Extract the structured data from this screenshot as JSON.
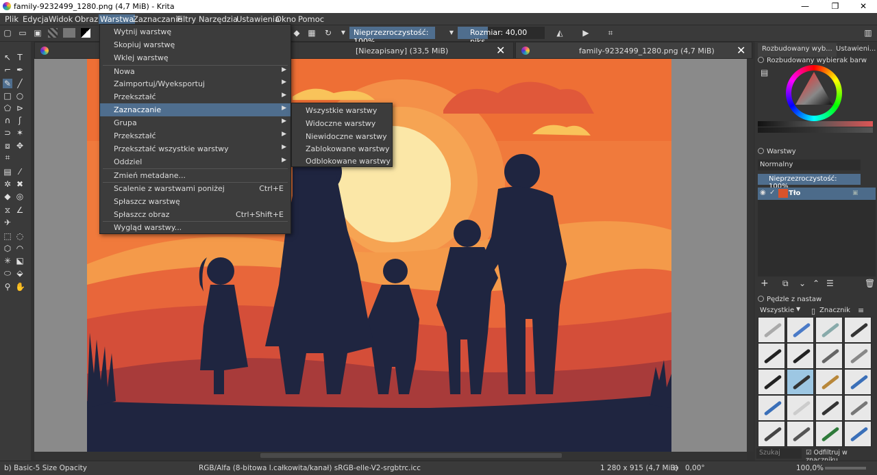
{
  "window": {
    "title": "family-9232499_1280.png (4,7 MiB)  - Krita",
    "minimize": "—",
    "maximize": "❐",
    "close": "✕"
  },
  "menubar": [
    "Plik",
    "Edycja",
    "Widok",
    "Obraz",
    "Warstwa",
    "Zaznaczanie",
    "Filtry",
    "Narzędzia",
    "Ustawienia",
    "Okno",
    "Pomoc"
  ],
  "menubar_active": "Warstwa",
  "toolbar": {
    "opacity": "Nieprzezroczystość: 100%",
    "size": "Rozmiar: 40,00 piks."
  },
  "tabs": [
    {
      "label": "[Niezapisany]  (33,5 MiB)",
      "close": "✕"
    },
    {
      "label": "family-9232499_1280.png (4,7 MiB)",
      "close": "✕"
    }
  ],
  "layer_menu": {
    "items": [
      {
        "label": "Wytnij warstwę"
      },
      {
        "label": "Skopiuj warstwę"
      },
      {
        "label": "Wklej warstwę"
      },
      {
        "label": "Nowa",
        "submenu": true
      },
      {
        "label": "Zaimportuj/Wyeksportuj",
        "submenu": true
      },
      {
        "label": "Przekształć",
        "submenu": true
      },
      {
        "label": "Zaznaczanie",
        "submenu": true,
        "highlighted": true
      },
      {
        "label": "Grupa",
        "submenu": true
      },
      {
        "label": "Przekształć",
        "submenu": true
      },
      {
        "label": "Przekształć wszystkie warstwy",
        "submenu": true
      },
      {
        "label": "Oddziel",
        "submenu": true
      },
      {
        "label": "Zmień metadane..."
      },
      {
        "label": "Scalenie z warstwami poniżej",
        "shortcut": "Ctrl+E"
      },
      {
        "label": "Spłaszcz warstwę"
      },
      {
        "label": "Spłaszcz obraz",
        "shortcut": "Ctrl+Shift+E"
      },
      {
        "label": "Wygląd warstwy..."
      }
    ]
  },
  "selection_submenu": {
    "items": [
      "Wszystkie warstwy",
      "Widoczne warstwy",
      "Niewidoczne warstwy",
      "Zablokowane warstwy",
      "Odblokowane warstwy"
    ]
  },
  "dock": {
    "tab1": "Rozbudowany wyb...",
    "tab2": "Ustawieni...",
    "color_panel_title": "Rozbudowany wybierak barw",
    "layers_title": "Warstwy",
    "blend_mode": "Normalny",
    "layer_opacity": "Nieprzezroczystość:  100%",
    "layer_name": "Tło",
    "brushes_title": "Pędzle z nastaw",
    "brush_filter": "Wszystkie",
    "brush_tag": "Znacznik",
    "search_placeholder": "Szukaj",
    "filter_label": "Odfiltruj w znaczniku"
  },
  "status": {
    "brush": "b) Basic-5 Size Opacity",
    "color_model": "RGB/Alfa (8-bitowa l.całkowita/kanał)  sRGB-elle-V2-srgbtrc.icc",
    "dimensions": "1 280 x 915 (4,7 MiB)",
    "rotation": "0,00°",
    "zoom": "100,0%"
  },
  "colors": {
    "accent": "#4f6e8e",
    "sky_top": "#f07a3c",
    "sun": "#fbe7a7",
    "silhouette": "#1f2540"
  }
}
